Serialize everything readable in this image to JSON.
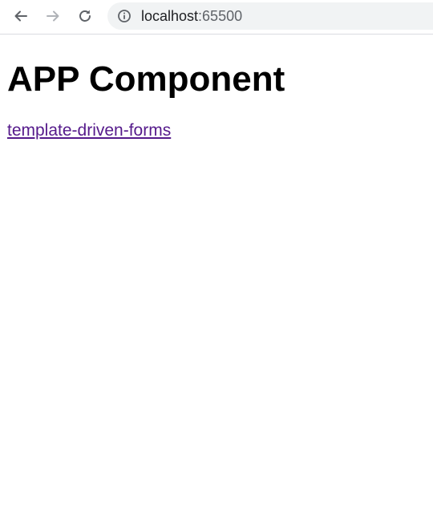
{
  "browser": {
    "url_host": "localhost",
    "url_port": ":65500",
    "icons": {
      "back": "back-arrow-icon",
      "forward": "forward-arrow-icon",
      "reload": "reload-icon",
      "site_info": "info-icon"
    },
    "colors": {
      "omnibox_bg": "#f1f3f4",
      "icon_active": "#5f6368",
      "icon_disabled": "#b0b3b8"
    }
  },
  "page": {
    "heading": "APP Component",
    "link_label": "template-driven-forms",
    "colors": {
      "link_visited": "#551a8b"
    }
  }
}
